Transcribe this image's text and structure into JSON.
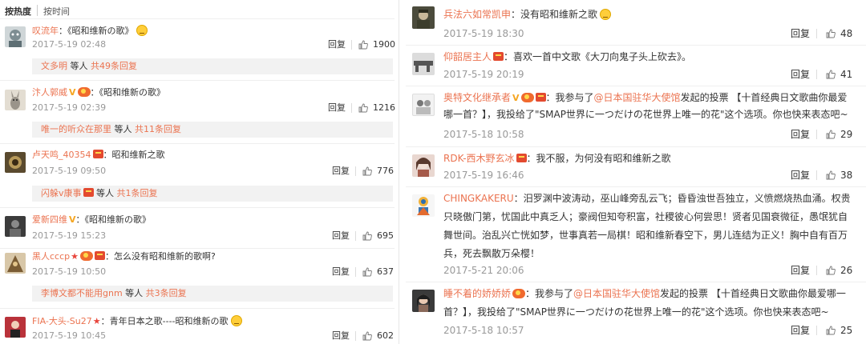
{
  "sort": {
    "hot": "按热度",
    "time": "按时间"
  },
  "left": [
    {
      "user": "叹流年",
      "badges": [],
      "sep": "：",
      "text": "《昭和维新の歌》",
      "emoji": true,
      "date": "2017-5-19 02:48",
      "reply": "回复",
      "likes": "1900",
      "sub": {
        "user": "文多明",
        "etc": "等人",
        "count": "共49条回复"
      }
    },
    {
      "user": "汴人郭威",
      "badges": [
        "v",
        "vip"
      ],
      "sep": "：",
      "text": "《昭和维新の歌》",
      "emoji": false,
      "date": "2017-5-19 02:39",
      "reply": "回复",
      "likes": "1216",
      "sub": {
        "user": "唯一的听众在那里",
        "etc": "等人",
        "count": "共11条回复"
      }
    },
    {
      "user": "卢天鸣_40354",
      "badges": [
        "red"
      ],
      "sep": "：",
      "text": "昭和维新之歌",
      "emoji": false,
      "date": "2017-5-19 09:50",
      "reply": "回复",
      "likes": "776",
      "sub": {
        "user": "闪躲v康事",
        "etc": "等人",
        "count": "共1条回复"
      }
    },
    {
      "user": "爱新四维",
      "badges": [
        "v"
      ],
      "sep": "：",
      "text": "《昭和维新の歌》",
      "emoji": false,
      "date": "2017-5-19 15:23",
      "reply": "回复",
      "likes": "695",
      "sub": null
    },
    {
      "user": "黑人cccp",
      "badges": [
        "star",
        "vip",
        "red"
      ],
      "sep": "：",
      "text": "怎么没有昭和维新的歌啊?",
      "emoji": false,
      "date": "2017-5-19 10:50",
      "reply": "回复",
      "likes": "637",
      "sub": {
        "user": "李博文都不能用gnm",
        "etc": "等人",
        "count": "共3条回复"
      }
    },
    {
      "user": "FIA-大头-Su27",
      "badges": [
        "star"
      ],
      "sep": "：",
      "text": "青年日本之歌----昭和维新の歌",
      "emoji": true,
      "date": "2017-5-19 10:45",
      "reply": "回复",
      "likes": "602",
      "sub": null
    }
  ],
  "right": [
    {
      "user": "兵法六如常凯申",
      "badges": [],
      "lines": [
        "：没有昭和维新之歌"
      ],
      "emoji": true,
      "date": "2017-5-19 18:30",
      "reply": "回复",
      "likes": "48"
    },
    {
      "user": "仰韶居主人",
      "badges": [
        "red"
      ],
      "lines": [
        "：喜欢一首中文歌《大刀向鬼子头上砍去》。"
      ],
      "emoji": false,
      "date": "2017-5-19 20:19",
      "reply": "回复",
      "likes": "41"
    },
    {
      "user": "奥特文化继承者",
      "badges": [
        "v",
        "vip",
        "red"
      ],
      "lines": [
        "：我参与了",
        "发起的投票 【十首经典日文歌曲你最爱",
        "哪一首？】，我投给了\"SMAP世界に一つだけの花世界上唯一的花\"这个选项。你也快来表态吧~"
      ],
      "mention": "@日本国驻华大使馆",
      "emoji": false,
      "date": "2017-5-18 10:58",
      "reply": "回复",
      "likes": "29"
    },
    {
      "user": "RDK-西木野玄冰",
      "badges": [
        "red"
      ],
      "lines": [
        "：我不服，为何没有昭和维新之歌"
      ],
      "emoji": false,
      "date": "2017-5-19 16:46",
      "reply": "回复",
      "likes": "38"
    },
    {
      "user": "CHINGKAKERU",
      "badges": [],
      "lines": [
        "：汨罗渊中波涛动，巫山峰旁乱云飞；昏昏浊世吾独立，义愤燃烧热血涌。权贵",
        "只晓傲门第，忧国此中真乏人；豪阀但知夸积富，社稷彼心何尝思！贤者见国衰微征，愚氓犹自",
        "舞世间。治乱兴亡恍如梦，世事真若一局棋！昭和维新春空下，男儿连结为正义！胸中自有百万",
        "兵，死去飘散万朵樱！"
      ],
      "emoji": false,
      "date": "2017-5-21 20:06",
      "reply": "回复",
      "likes": "26"
    },
    {
      "user": "睡不着的娇娇娇",
      "badges": [
        "vip"
      ],
      "lines": [
        "：我参与了",
        "发起的投票 【十首经典日文歌曲你最爱哪一",
        "首？】，我投给了\"SMAP世界に一つだけの花世界上唯一的花\"这个选项。你也快来表态吧~"
      ],
      "mention": "@日本国驻华大使馆",
      "emoji": false,
      "date": "2017-5-18 10:57",
      "reply": "回复",
      "likes": "25"
    }
  ]
}
